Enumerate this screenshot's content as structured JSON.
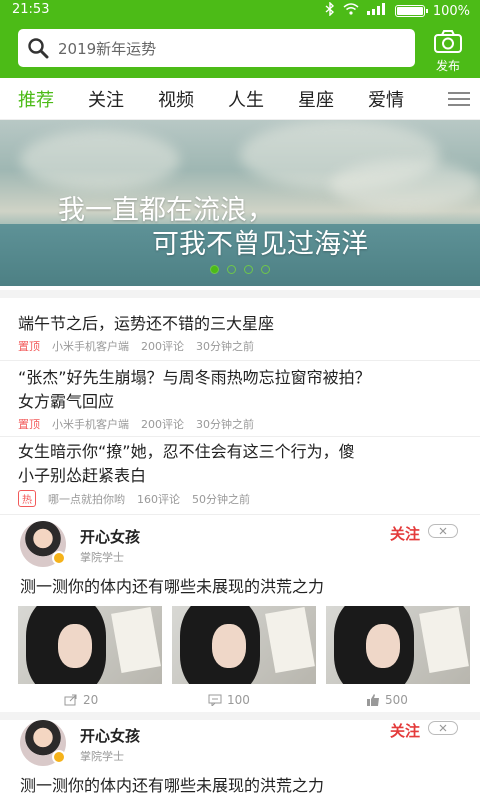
{
  "status": {
    "time": "21:53",
    "battery": "100%",
    "battery_level": 1.0
  },
  "search": {
    "placeholder": "2019新年运势"
  },
  "publish": {
    "label": "发布"
  },
  "tabs": [
    "推荐",
    "关注",
    "视频",
    "人生",
    "星座",
    "爱情"
  ],
  "banner": {
    "line1": "我一直都在流浪，",
    "line2": "可我不曾见过海洋",
    "active_dot": 0,
    "dot_count": 4
  },
  "news": [
    {
      "title": "端午节之后，运势还不错的三大星座",
      "tag": "置顶",
      "source": "小米手机客户端",
      "comments": "200评论",
      "time": "30分钟之前"
    },
    {
      "title_l1": "“张杰”好先生崩塌？与周冬雨热吻忘拉窗帘被拍？",
      "title_l2": "女方霸气回应",
      "tag": "置顶",
      "source": "小米手机客户端",
      "comments": "200评论",
      "time": "30分钟之前"
    },
    {
      "title_l1": "女生暗示你“撩”她，忍不住会有这三个行为，傻",
      "title_l2": "小子别怂赶紧表白",
      "tag": "热",
      "source": "哪一点就拍你哟",
      "comments": "160评论",
      "time": "50分钟之前"
    }
  ],
  "posts": [
    {
      "name": "开心女孩",
      "level": "掌院学士",
      "follow": "关注",
      "text": "测一测你的体内还有哪些未展现的洪荒之力",
      "share": "20",
      "comments": "100",
      "likes": "500"
    },
    {
      "name": "开心女孩",
      "level": "掌院学士",
      "follow": "关注",
      "text": "测一测你的体内还有哪些未展现的洪荒之力"
    }
  ],
  "colors": {
    "brand_green": "#4cbb17",
    "follow_red": "#e43b3b"
  }
}
